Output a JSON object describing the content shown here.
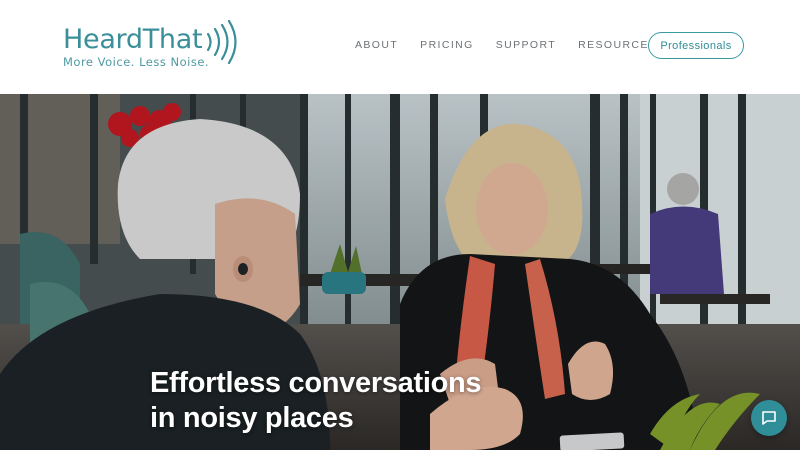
{
  "brand": {
    "name": "HeardThat",
    "tagline": "More Voice. Less Noise.",
    "color": "#3a8f98"
  },
  "nav": {
    "items": [
      {
        "label": "ABOUT"
      },
      {
        "label": "PRICING"
      },
      {
        "label": "SUPPORT"
      },
      {
        "label": "RESOURCES"
      }
    ],
    "cta_label": "Professionals"
  },
  "hero": {
    "title_line1": "Effortless conversations",
    "title_line2": "in noisy places"
  },
  "icons": {
    "logo": "sound-waves-icon",
    "chat": "chat-bubble-icon"
  },
  "colors": {
    "accent": "#2f8e98",
    "nav_text": "#6d7275"
  }
}
